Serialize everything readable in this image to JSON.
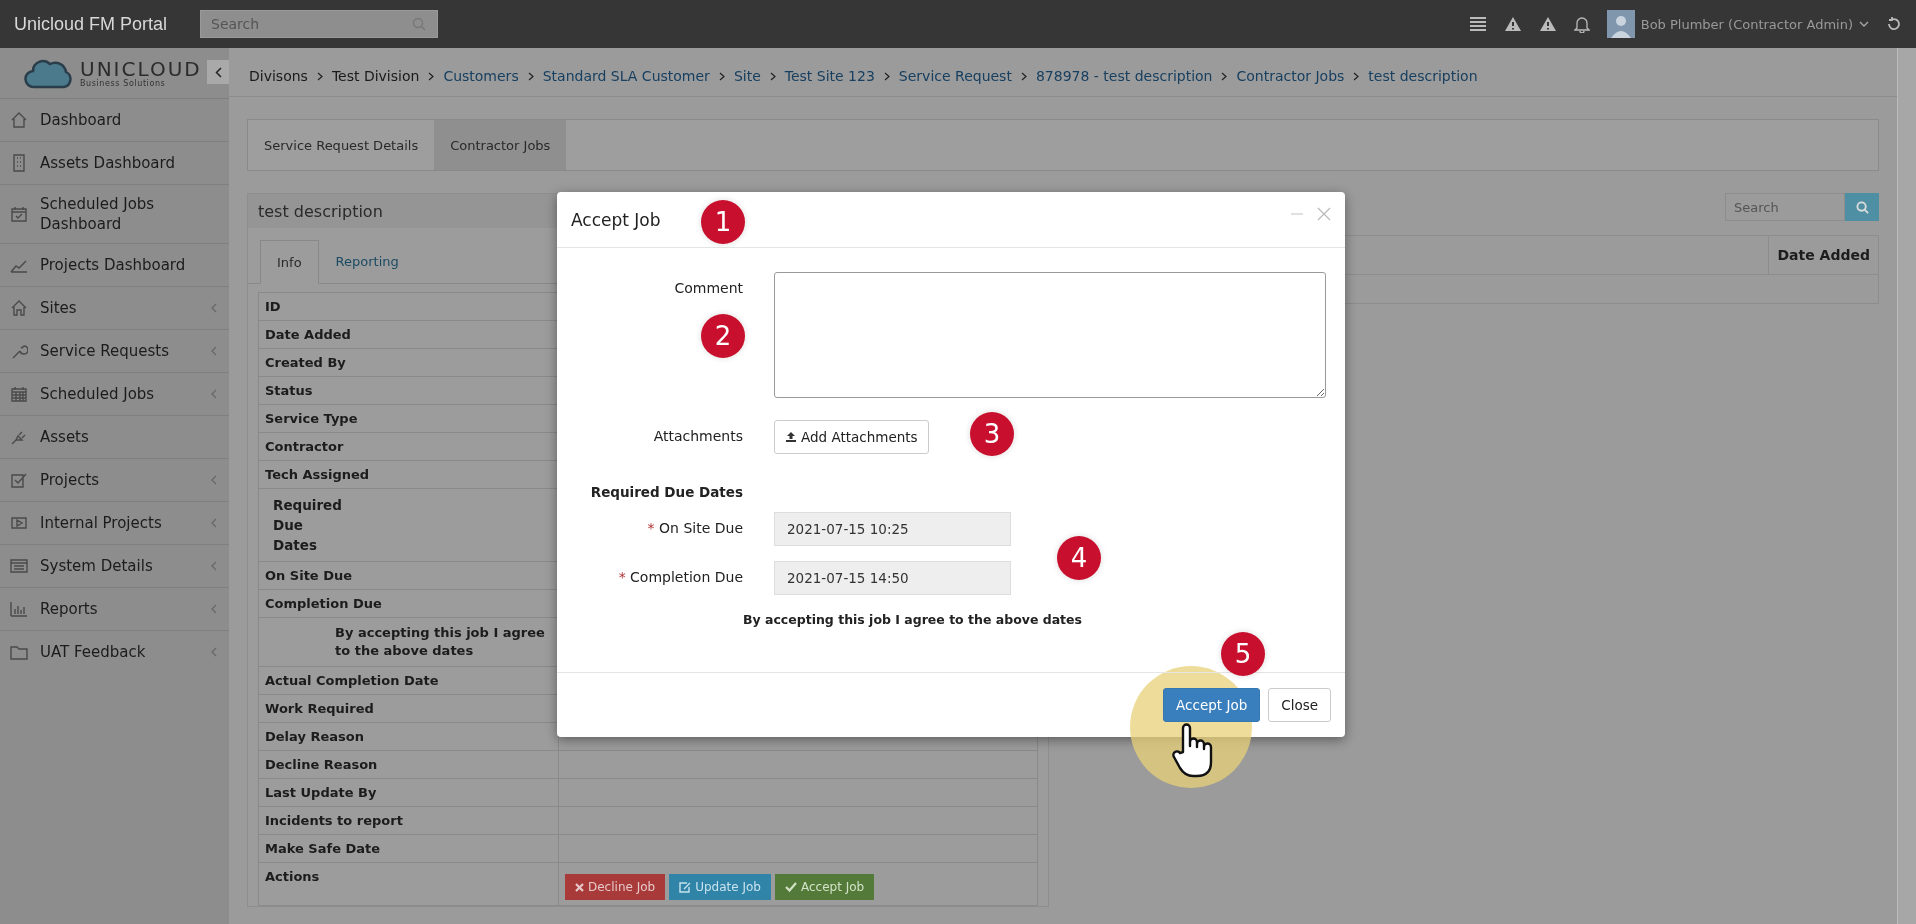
{
  "app": {
    "title": "Unicloud FM Portal",
    "search_placeholder": "Search",
    "user": "Bob Plumber (Contractor Admin)"
  },
  "logo": {
    "name": "UNICLOUD",
    "tagline": "Business Solutions"
  },
  "breadcrumb": [
    {
      "label": "Divisons",
      "link": false
    },
    {
      "label": "Test Division",
      "link": false
    },
    {
      "label": "Customers",
      "link": true
    },
    {
      "label": "Standard SLA Customer",
      "link": true
    },
    {
      "label": "Site",
      "link": true
    },
    {
      "label": "Test Site 123",
      "link": true
    },
    {
      "label": "Service Request",
      "link": true
    },
    {
      "label": "878978 - test description",
      "link": true
    },
    {
      "label": "Contractor Jobs",
      "link": true
    },
    {
      "label": "test description",
      "link": true
    }
  ],
  "sidebar": {
    "items": [
      {
        "label": "Dashboard",
        "has_children": false
      },
      {
        "label": "Assets Dashboard",
        "has_children": false
      },
      {
        "label": "Scheduled Jobs Dashboard",
        "has_children": false
      },
      {
        "label": "Projects Dashboard",
        "has_children": false
      },
      {
        "label": "Sites",
        "has_children": true
      },
      {
        "label": "Service Requests",
        "has_children": true
      },
      {
        "label": "Scheduled Jobs",
        "has_children": true
      },
      {
        "label": "Assets",
        "has_children": false
      },
      {
        "label": "Projects",
        "has_children": true
      },
      {
        "label": "Internal Projects",
        "has_children": true
      },
      {
        "label": "System Details",
        "has_children": true
      },
      {
        "label": "Reports",
        "has_children": true
      },
      {
        "label": "UAT Feedback",
        "has_children": true
      }
    ]
  },
  "page_tabs": [
    {
      "label": "Service Request Details",
      "selected": false
    },
    {
      "label": "Contractor Jobs",
      "selected": true
    }
  ],
  "job_panel": {
    "title": "test description",
    "tabs": [
      {
        "label": "Info",
        "selected": true
      },
      {
        "label": "Reporting",
        "selected": false
      }
    ],
    "rows": [
      {
        "label": "ID",
        "kind": "field"
      },
      {
        "label": "Date Added",
        "kind": "field"
      },
      {
        "label": "Created By",
        "kind": "field"
      },
      {
        "label": "Status",
        "kind": "field"
      },
      {
        "label": "Service Type",
        "kind": "field"
      },
      {
        "label": "Contractor",
        "kind": "field"
      },
      {
        "label": "Tech Assigned",
        "kind": "field"
      },
      {
        "label": "Required Due Dates",
        "kind": "subheading"
      },
      {
        "label": "On Site Due",
        "kind": "field"
      },
      {
        "label": "Completion Due",
        "kind": "field"
      },
      {
        "label": "By accepting this job I agree to the above dates",
        "kind": "note"
      },
      {
        "label": "Actual Completion Date",
        "kind": "field"
      },
      {
        "label": "Work Required",
        "kind": "field"
      },
      {
        "label": "Delay Reason",
        "kind": "field"
      },
      {
        "label": "Decline Reason",
        "kind": "field"
      },
      {
        "label": "Last Update By",
        "kind": "field"
      },
      {
        "label": "Incidents to report",
        "kind": "field"
      },
      {
        "label": "Make Safe Date",
        "kind": "field"
      },
      {
        "label": "Actions",
        "kind": "actions"
      }
    ],
    "actions": [
      {
        "label": "Decline Job",
        "kind": "decline"
      },
      {
        "label": "Update Job",
        "kind": "update"
      },
      {
        "label": "Accept Job",
        "kind": "accept"
      }
    ]
  },
  "jobs_list": {
    "search_placeholder": "Search",
    "columns": [
      "Date Added"
    ]
  },
  "modal": {
    "title": "Accept Job",
    "required_mark": "*",
    "comment_label": "Comment",
    "attachments_label": "Attachments",
    "add_attachments": "Add Attachments",
    "section": "Required Due Dates",
    "fields": [
      {
        "label": "On Site Due",
        "value": "2021-07-15 10:25",
        "required": true
      },
      {
        "label": "Completion Due",
        "value": "2021-07-15 14:50",
        "required": true
      }
    ],
    "agreement": "By accepting this job I agree to the above dates",
    "buttons": [
      {
        "label": "Accept Job",
        "kind": "primary"
      },
      {
        "label": "Close",
        "kind": "default"
      }
    ]
  },
  "callouts": [
    "1",
    "2",
    "3",
    "4",
    "5"
  ]
}
